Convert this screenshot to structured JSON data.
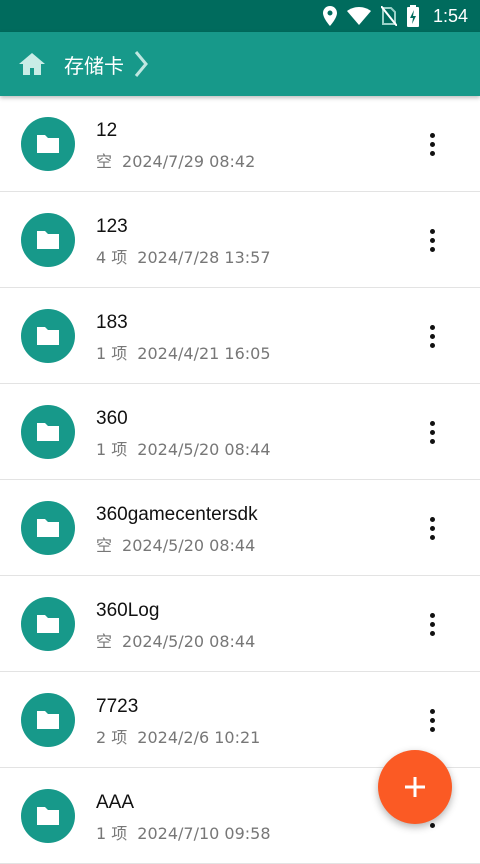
{
  "status_bar": {
    "time": "1:54",
    "icons": [
      "location-icon",
      "wifi-icon",
      "no-sim-icon",
      "battery-charging-icon"
    ]
  },
  "appbar": {
    "breadcrumb": "存储卡",
    "icons": [
      "home-icon",
      "chevron-right-icon"
    ]
  },
  "colors": {
    "status_bar": "#006b5d",
    "appbar": "#17998a",
    "folder": "#17998a",
    "fab": "#fb5a24"
  },
  "files": [
    {
      "name": "12",
      "count": "空",
      "date": "2024/7/29 08:42"
    },
    {
      "name": "123",
      "count": "4 项",
      "date": "2024/7/28 13:57"
    },
    {
      "name": "183",
      "count": "1 项",
      "date": "2024/4/21 16:05"
    },
    {
      "name": "360",
      "count": "1 项",
      "date": "2024/5/20 08:44"
    },
    {
      "name": "360gamecentersdk",
      "count": "空",
      "date": "2024/5/20 08:44"
    },
    {
      "name": "360Log",
      "count": "空",
      "date": "2024/5/20 08:44"
    },
    {
      "name": "7723",
      "count": "2 项",
      "date": "2024/2/6 10:21"
    },
    {
      "name": "AAA",
      "count": "1 项",
      "date": "2024/7/10 09:58"
    }
  ],
  "fab": {
    "icon": "plus-icon"
  }
}
